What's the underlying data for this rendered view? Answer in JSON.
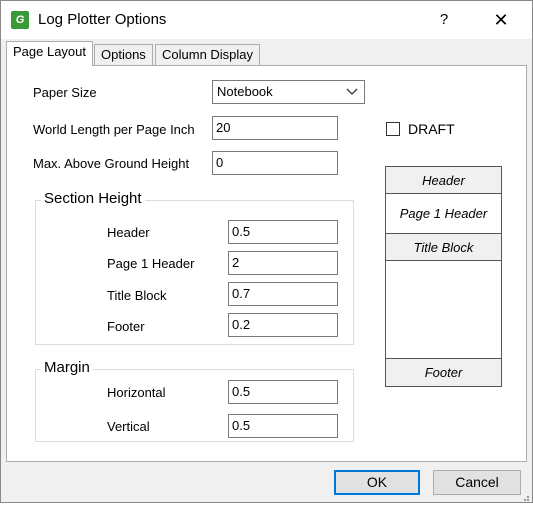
{
  "window": {
    "title": "Log Plotter Options",
    "help_glyph": "?",
    "close_glyph": "✕",
    "app_icon_glyph": "G"
  },
  "tabs": [
    {
      "label": "Page Layout",
      "active": true
    },
    {
      "label": "Options",
      "active": false
    },
    {
      "label": "Column Display",
      "active": false
    }
  ],
  "page_layout": {
    "paper_size": {
      "label": "Paper Size",
      "value": "Notebook"
    },
    "world_length": {
      "label": "World Length per Page Inch",
      "value": "20"
    },
    "max_above_ground": {
      "label": "Max. Above Ground Height",
      "value": "0"
    },
    "draft": {
      "label": "DRAFT",
      "checked": false
    },
    "section_height": {
      "title": "Section Height",
      "header": {
        "label": "Header",
        "value": "0.5"
      },
      "page1_header": {
        "label": "Page 1 Header",
        "value": "2"
      },
      "title_block": {
        "label": "Title Block",
        "value": "0.7"
      },
      "footer": {
        "label": "Footer",
        "value": "0.2"
      }
    },
    "margin": {
      "title": "Margin",
      "horizontal": {
        "label": "Horizontal",
        "value": "0.5"
      },
      "vertical": {
        "label": "Vertical",
        "value": "0.5"
      }
    },
    "preview": {
      "header": "Header",
      "page1_header": "Page 1 Header",
      "title_block": "Title Block",
      "footer": "Footer"
    }
  },
  "buttons": {
    "ok": "OK",
    "cancel": "Cancel"
  }
}
